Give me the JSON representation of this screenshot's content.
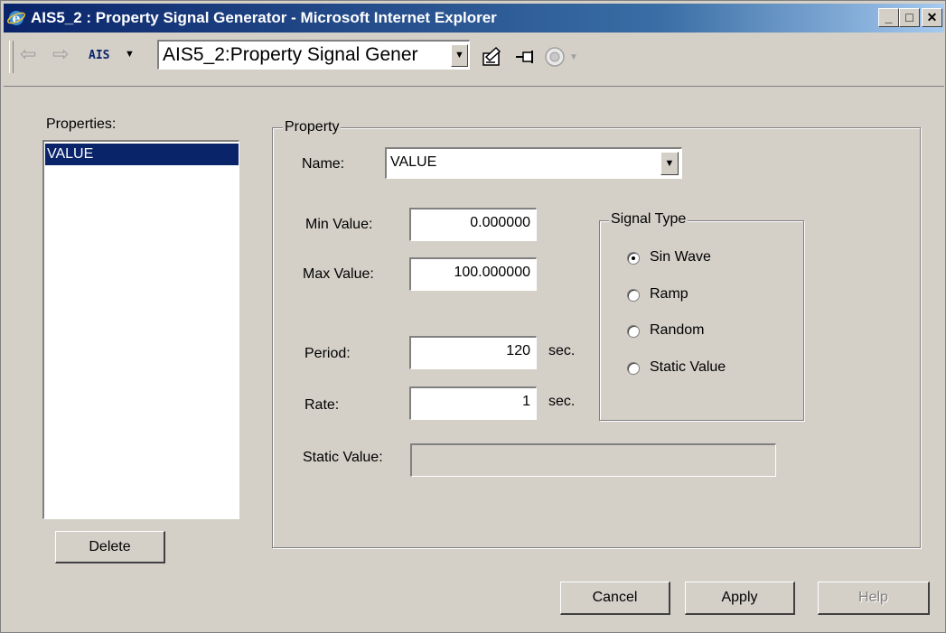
{
  "window": {
    "title": "AIS5_2 : Property Signal Generator - Microsoft Internet Explorer",
    "controls": {
      "minimize": "_",
      "maximize": "□",
      "close": "✕"
    }
  },
  "toolbar": {
    "back_icon": "back-arrow-icon",
    "forward_icon": "forward-arrow-icon",
    "ais_label": "AIS",
    "address_value": "AIS5_2:Property Signal Gener",
    "icons": [
      "edit-page-icon",
      "pin-icon",
      "view-icon"
    ]
  },
  "properties": {
    "label": "Properties:",
    "items": [
      "VALUE"
    ],
    "delete_label": "Delete"
  },
  "property": {
    "group_label": "Property",
    "name_label": "Name:",
    "name_value": "VALUE",
    "min_label": "Min Value:",
    "min_value": "0.000000",
    "max_label": "Max Value:",
    "max_value": "100.000000",
    "period_label": "Period:",
    "period_value": "120",
    "period_unit": "sec.",
    "rate_label": "Rate:",
    "rate_value": "1",
    "rate_unit": "sec.",
    "static_label": "Static Value:",
    "static_value": ""
  },
  "signal_type": {
    "group_label": "Signal Type",
    "options": [
      "Sin Wave",
      "Ramp",
      "Random",
      "Static Value"
    ],
    "selected": "Sin Wave"
  },
  "buttons": {
    "cancel": "Cancel",
    "apply": "Apply",
    "help": "Help"
  },
  "colors": {
    "title_bar": "#0a246a",
    "face": "#d4d0c8",
    "selection": "#0a246a",
    "disabled_text": "#808080"
  }
}
